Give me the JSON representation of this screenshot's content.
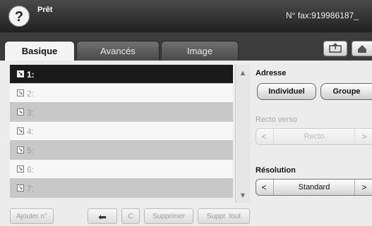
{
  "header": {
    "status": "Prêt",
    "fax_number": "N° fax:919986187_",
    "help_icon": "?"
  },
  "tabs": [
    {
      "label": "Basique"
    },
    {
      "label": "Avancés"
    },
    {
      "label": "Image"
    }
  ],
  "list": {
    "items": [
      {
        "label": "1:"
      },
      {
        "label": "2:"
      },
      {
        "label": "3:"
      },
      {
        "label": "4:"
      },
      {
        "label": "5:"
      },
      {
        "label": "6:"
      },
      {
        "label": "7:"
      }
    ]
  },
  "bottom_buttons": {
    "add": "Ajouter n°",
    "back": "⬅",
    "clear": "C",
    "delete": "Supprimer",
    "delete_all": "Suppr. tout"
  },
  "settings": {
    "address": {
      "title": "Adresse",
      "individual": "Individuel",
      "group": "Groupe"
    },
    "duplex": {
      "title": "Recto verso",
      "value": "Recto"
    },
    "resolution": {
      "title": "Résolution",
      "value": "Standard"
    }
  }
}
